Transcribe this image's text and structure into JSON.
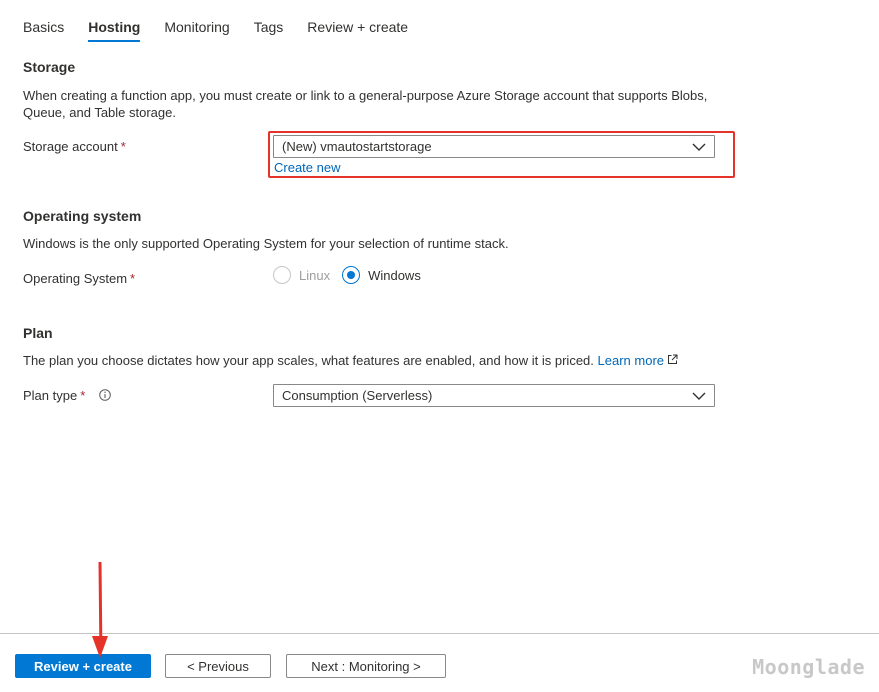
{
  "tabs": [
    {
      "label": "Basics",
      "active": false
    },
    {
      "label": "Hosting",
      "active": true
    },
    {
      "label": "Monitoring",
      "active": false
    },
    {
      "label": "Tags",
      "active": false
    },
    {
      "label": "Review + create",
      "active": false
    }
  ],
  "storage": {
    "title": "Storage",
    "description": "When creating a function app, you must create or link to a general-purpose Azure Storage account that supports Blobs, Queue, and Table storage.",
    "account_label": "Storage account",
    "required_mark": "*",
    "account_value": "(New) vmautostartstorage",
    "create_new_label": "Create new",
    "highlight_color": "#e5332a"
  },
  "operating_system": {
    "title": "Operating system",
    "description": "Windows is the only supported Operating System for your selection of runtime stack.",
    "label": "Operating System",
    "required_mark": "*",
    "options": [
      {
        "label": "Linux",
        "checked": false,
        "disabled": true
      },
      {
        "label": "Windows",
        "checked": true,
        "disabled": false
      }
    ]
  },
  "plan": {
    "title": "Plan",
    "description": "The plan you choose dictates how your app scales, what features are enabled, and how it is priced.",
    "learn_more_label": "Learn more",
    "type_label": "Plan type",
    "required_mark": "*",
    "type_value": "Consumption (Serverless)"
  },
  "footer": {
    "review_create_label": "Review + create",
    "previous_label": "< Previous",
    "next_label": "Next : Monitoring >"
  },
  "watermark": "Moonglade",
  "colors": {
    "accent": "#0078d4",
    "link": "#0067b8",
    "required": "#a4262c",
    "annotation": "#e5332a"
  }
}
